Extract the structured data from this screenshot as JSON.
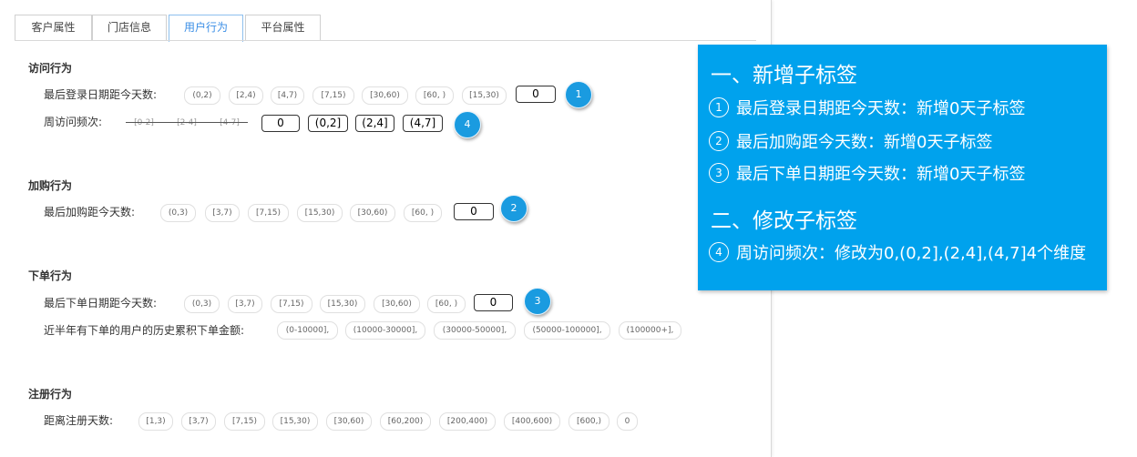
{
  "tabs": [
    {
      "label": "客户属性",
      "active": false
    },
    {
      "label": "门店信息",
      "active": false
    },
    {
      "label": "用户行为",
      "active": true
    },
    {
      "label": "平台属性",
      "active": false
    }
  ],
  "sections": {
    "visit": {
      "title": "访问行为",
      "last_login": {
        "label": "最后登录日期距今天数:",
        "options": [
          "(0,2)",
          "[2,4)",
          "[4,7)",
          "[7,15)",
          "[30,60)",
          "[60, )",
          "[15,30)"
        ],
        "new_option": "0",
        "marker": "1"
      },
      "weekly_freq": {
        "label": "周访问频次:",
        "old_options": [
          "[0-2]",
          "[2-4]",
          "[4-7]"
        ],
        "new_options": [
          "0",
          "(0,2]",
          "(2,4]",
          "(4,7]"
        ],
        "marker": "4"
      }
    },
    "cart": {
      "title": "加购行为",
      "last_cart": {
        "label": "最后加购距今天数:",
        "options": [
          "(0,3)",
          "[3,7)",
          "[7,15)",
          "[15,30)",
          "[30,60)",
          "[60, )"
        ],
        "new_option": "0",
        "marker": "2"
      }
    },
    "order": {
      "title": "下单行为",
      "last_order": {
        "label": "最后下单日期距今天数:",
        "options": [
          "(0,3)",
          "[3,7)",
          "[7,15)",
          "[15,30)",
          "[30,60)",
          "[60, )"
        ],
        "new_option": "0",
        "marker": "3"
      },
      "amount": {
        "label": "近半年有下单的用户的历史累积下单金额:",
        "options": [
          "(0-10000],",
          "(10000-30000],",
          "(30000-50000],",
          "(50000-100000],",
          "(100000+],"
        ]
      }
    },
    "register": {
      "title": "注册行为",
      "days": {
        "label": "距离注册天数:",
        "options": [
          "[1,3)",
          "[3,7)",
          "[7,15)",
          "[15,30)",
          "[30,60)",
          "[60,200)",
          "[200,400)",
          "[400,600)",
          "[600,)",
          "0"
        ]
      }
    }
  },
  "note": {
    "heading1": "一、新增子标签",
    "items1": [
      {
        "num": "1",
        "text": "最后登录日期距今天数：新增0天子标签"
      },
      {
        "num": "2",
        "text": "最后加购距今天数：新增0天子标签"
      },
      {
        "num": "3",
        "text": "最后下单日期距今天数：新增0天子标签"
      }
    ],
    "heading2": "二、修改子标签",
    "items2": [
      {
        "num": "4",
        "text": "周访问频次：修改为0,(0,2],(2,4],(4,7]4个维度"
      }
    ]
  },
  "colors": {
    "accent": "#3a8ee6",
    "note_bg": "#00a2ed",
    "marker": "#1a9be0"
  }
}
